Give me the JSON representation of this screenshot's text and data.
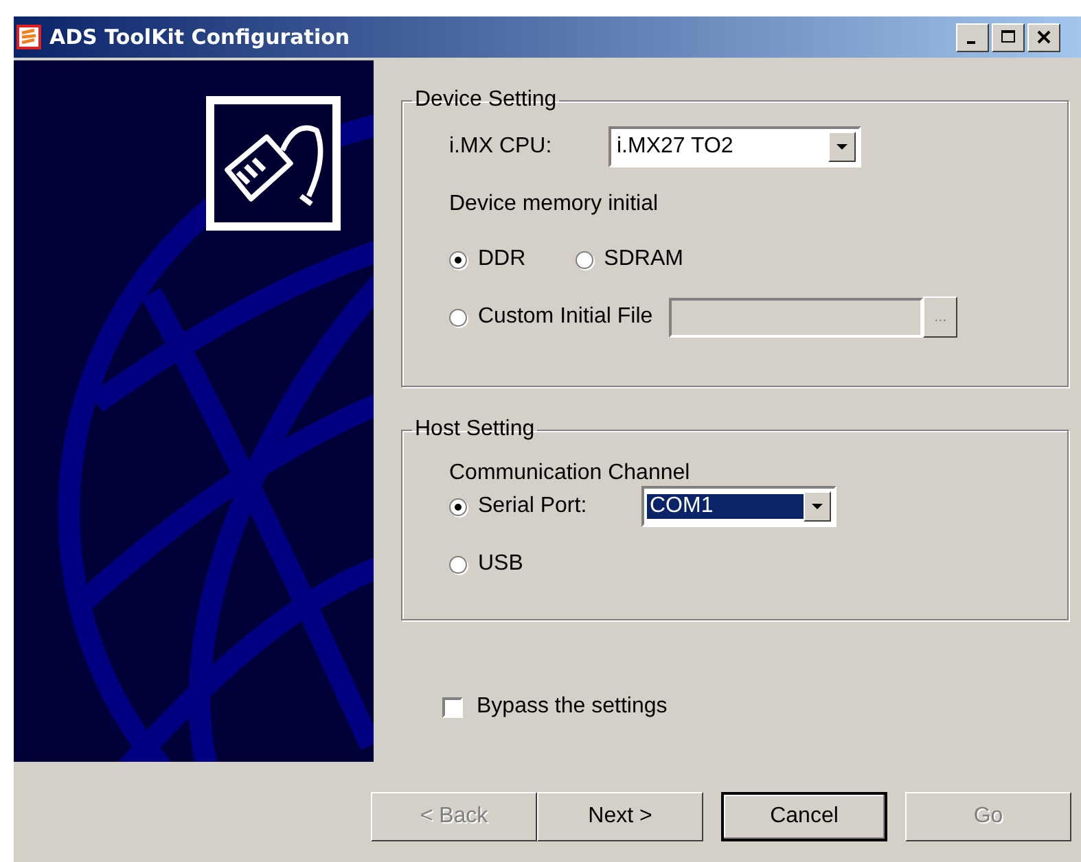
{
  "window": {
    "title": "ADS ToolKit Configuration"
  },
  "device_setting": {
    "title": "Device Setting",
    "cpu_label": "i.MX CPU:",
    "cpu_value": "i.MX27 TO2",
    "memory_label": "Device memory initial",
    "memory_options": [
      {
        "label": "DDR",
        "selected": true
      },
      {
        "label": "SDRAM",
        "selected": false
      },
      {
        "label": "Custom Initial File",
        "selected": false
      }
    ],
    "custom_file": {
      "disabled": true,
      "browse_label": "..."
    }
  },
  "host_setting": {
    "title": "Host Setting",
    "channel_label": "Communication Channel",
    "channel_options": [
      {
        "label": "Serial Port:",
        "selected": true
      },
      {
        "label": "USB",
        "selected": false
      }
    ],
    "port": {
      "value": "COM1",
      "highlighted": true
    }
  },
  "bypass": {
    "label": "Bypass the settings",
    "checked": false
  },
  "buttons": [
    {
      "label": "< Back",
      "disabled": true,
      "default": false
    },
    {
      "label": "Next >",
      "disabled": false,
      "default": false
    },
    {
      "label": "Cancel",
      "disabled": false,
      "default": true
    },
    {
      "label": "Go",
      "disabled": true,
      "default": false
    }
  ]
}
